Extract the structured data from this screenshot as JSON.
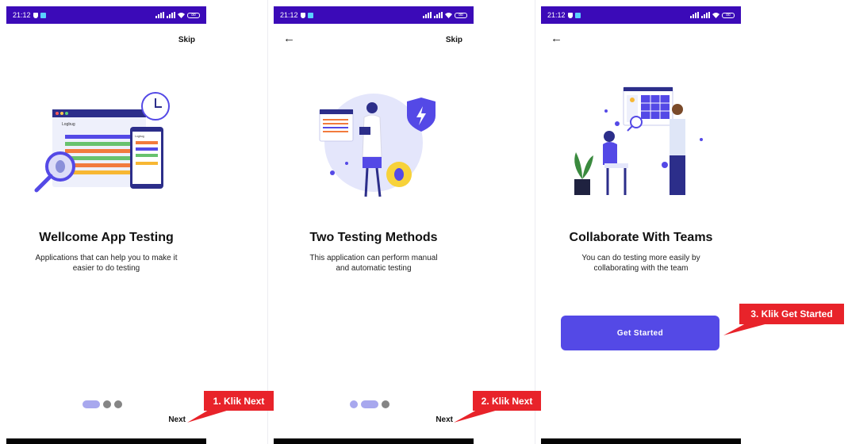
{
  "status_bar": {
    "time": "21:12",
    "battery": "88"
  },
  "screens": [
    {
      "skip": "Skip",
      "title": "Wellcome App Testing",
      "description": "Applications that can help you to make it easier to do testing",
      "next": "Next",
      "illustration_brand": "Logbug",
      "illustration_brand_small": "Logbug"
    },
    {
      "skip": "Skip",
      "title": "Two Testing Methods",
      "description": "This application can perform manual and automatic testing",
      "next": "Next"
    },
    {
      "title": "Collaborate With Teams",
      "description": "You can do testing more easily by collaborating with the team",
      "cta": "Get Started"
    }
  ],
  "callouts": [
    "1. Klik Next",
    "2. Klik Next",
    "3. Klik Get Started"
  ],
  "colors": {
    "status_bar": "#3b0ab8",
    "accent": "#5449e6",
    "dot_active": "#a8a8ee",
    "dot_inactive": "#858585",
    "callout": "#e8232a"
  },
  "icons": [
    "back-arrow-icon",
    "shield-icon",
    "signal-icon",
    "wifi-icon",
    "battery-icon"
  ]
}
